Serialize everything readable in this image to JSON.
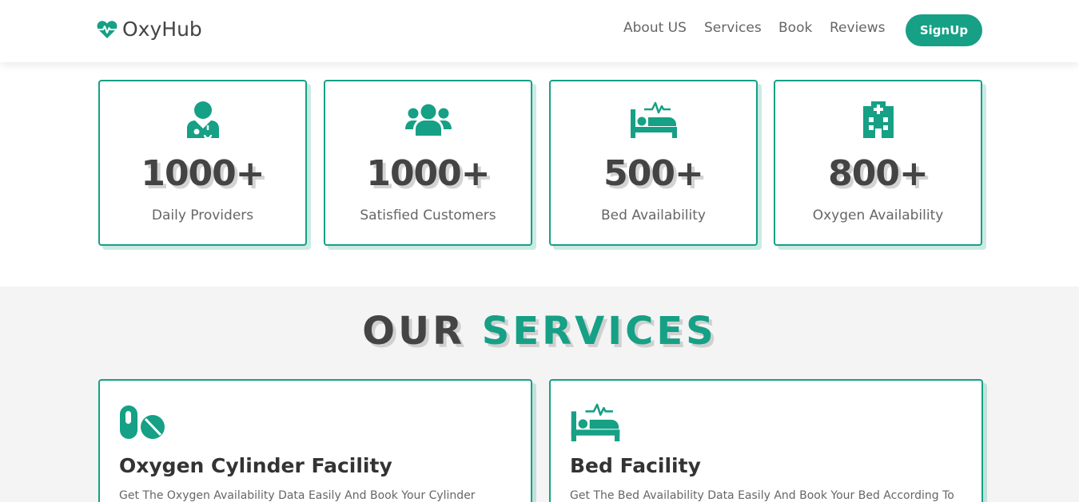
{
  "header": {
    "logo_text": "OxyHub",
    "logo_icon": "heartbeat-icon",
    "nav": {
      "about": "About US",
      "services": "Services",
      "book": "Book",
      "reviews": "Reviews"
    },
    "signup_label": "SignUp"
  },
  "stats": [
    {
      "icon": "doctor-icon",
      "value": "1000+",
      "label": "Daily Providers"
    },
    {
      "icon": "users-icon",
      "value": "1000+",
      "label": "Satisfied Customers"
    },
    {
      "icon": "bed-icon",
      "value": "500+",
      "label": "Bed Availability"
    },
    {
      "icon": "hospital-icon",
      "value": "800+",
      "label": "Oxygen Availability"
    }
  ],
  "services": {
    "title_part1": "OUR",
    "title_part2": "SERVICES",
    "cards": [
      {
        "icon": "pills-icon",
        "title": "Oxygen Cylinder Facility",
        "description": "Get The Oxygen Availability Data Easily And Book Your Cylinder"
      },
      {
        "icon": "bed-icon",
        "title": "Bed Facility",
        "description": "Get The Bed Availability Data Easily And Book Your Bed According To"
      }
    ]
  },
  "colors": {
    "accent": "#16a085",
    "text_dark": "#444444",
    "text_muted": "#666666",
    "section_bg": "#f4f4f4"
  }
}
